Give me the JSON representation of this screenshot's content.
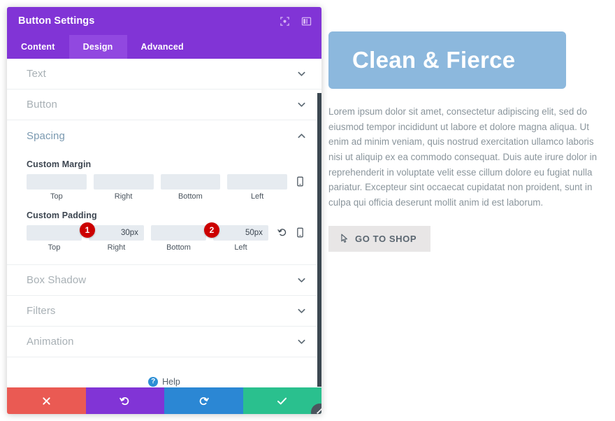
{
  "panel": {
    "title": "Button Settings",
    "header_icons": [
      {
        "name": "focus-target-icon"
      },
      {
        "name": "layout-columns-icon"
      }
    ],
    "tabs": [
      {
        "label": "Content",
        "active": false
      },
      {
        "label": "Design",
        "active": true
      },
      {
        "label": "Advanced",
        "active": false
      }
    ],
    "sections": [
      {
        "label": "Text",
        "open": false
      },
      {
        "label": "Button",
        "open": false
      },
      {
        "label": "Spacing",
        "open": true
      },
      {
        "label": "Box Shadow",
        "open": false
      },
      {
        "label": "Filters",
        "open": false
      },
      {
        "label": "Animation",
        "open": false
      }
    ],
    "spacing": {
      "margin": {
        "label": "Custom Margin",
        "fields": [
          {
            "caption": "Top",
            "value": "",
            "placeholder": ""
          },
          {
            "caption": "Right",
            "value": "",
            "placeholder": ""
          },
          {
            "caption": "Bottom",
            "value": "",
            "placeholder": ""
          },
          {
            "caption": "Left",
            "value": "",
            "placeholder": ""
          }
        ],
        "icons": [
          "mobile-device-icon"
        ]
      },
      "padding": {
        "label": "Custom Padding",
        "fields": [
          {
            "caption": "Top",
            "value": "",
            "placeholder": ""
          },
          {
            "caption": "Right",
            "value": "30px",
            "placeholder": ""
          },
          {
            "caption": "Bottom",
            "value": "",
            "placeholder": ""
          },
          {
            "caption": "Left",
            "value": "50px",
            "placeholder": ""
          }
        ],
        "icons": [
          "reset-undo-icon",
          "mobile-device-icon"
        ]
      },
      "badges": [
        {
          "number": "1",
          "color": "#cc0000"
        },
        {
          "number": "2",
          "color": "#cc0000"
        }
      ]
    },
    "help": {
      "label": "Help",
      "icon": "question-mark-icon"
    },
    "actions": [
      {
        "name": "cancel",
        "icon": "close-x-icon",
        "color": "#ea5a53"
      },
      {
        "name": "undo",
        "icon": "undo-arrow-icon",
        "color": "#8134d6"
      },
      {
        "name": "redo",
        "icon": "redo-arrow-icon",
        "color": "#2b87d4"
      },
      {
        "name": "save",
        "icon": "checkmark-icon",
        "color": "#2ac08e"
      }
    ],
    "resize_handle": {
      "icon": "resize-diagonal-icon"
    }
  },
  "preview": {
    "hero_title": "Clean & Fierce",
    "hero_bg": "#8cb8dd",
    "paragraph": "Lorem ipsum dolor sit amet, consectetur adipiscing elit, sed do eiusmod tempor incididunt ut labore et dolore magna aliqua. Ut enim ad minim veniam, quis nostrud exercitation ullamco laboris nisi ut aliquip ex ea commodo consequat. Duis aute irure dolor in reprehenderit in voluptate velit esse cillum dolore eu fugiat nulla pariatur. Excepteur sint occaecat cupidatat non proident, sunt in culpa qui officia deserunt mollit anim id est laborum.",
    "shop_button": {
      "label": "GO TO SHOP",
      "icon": "cursor-pointer-icon"
    }
  }
}
